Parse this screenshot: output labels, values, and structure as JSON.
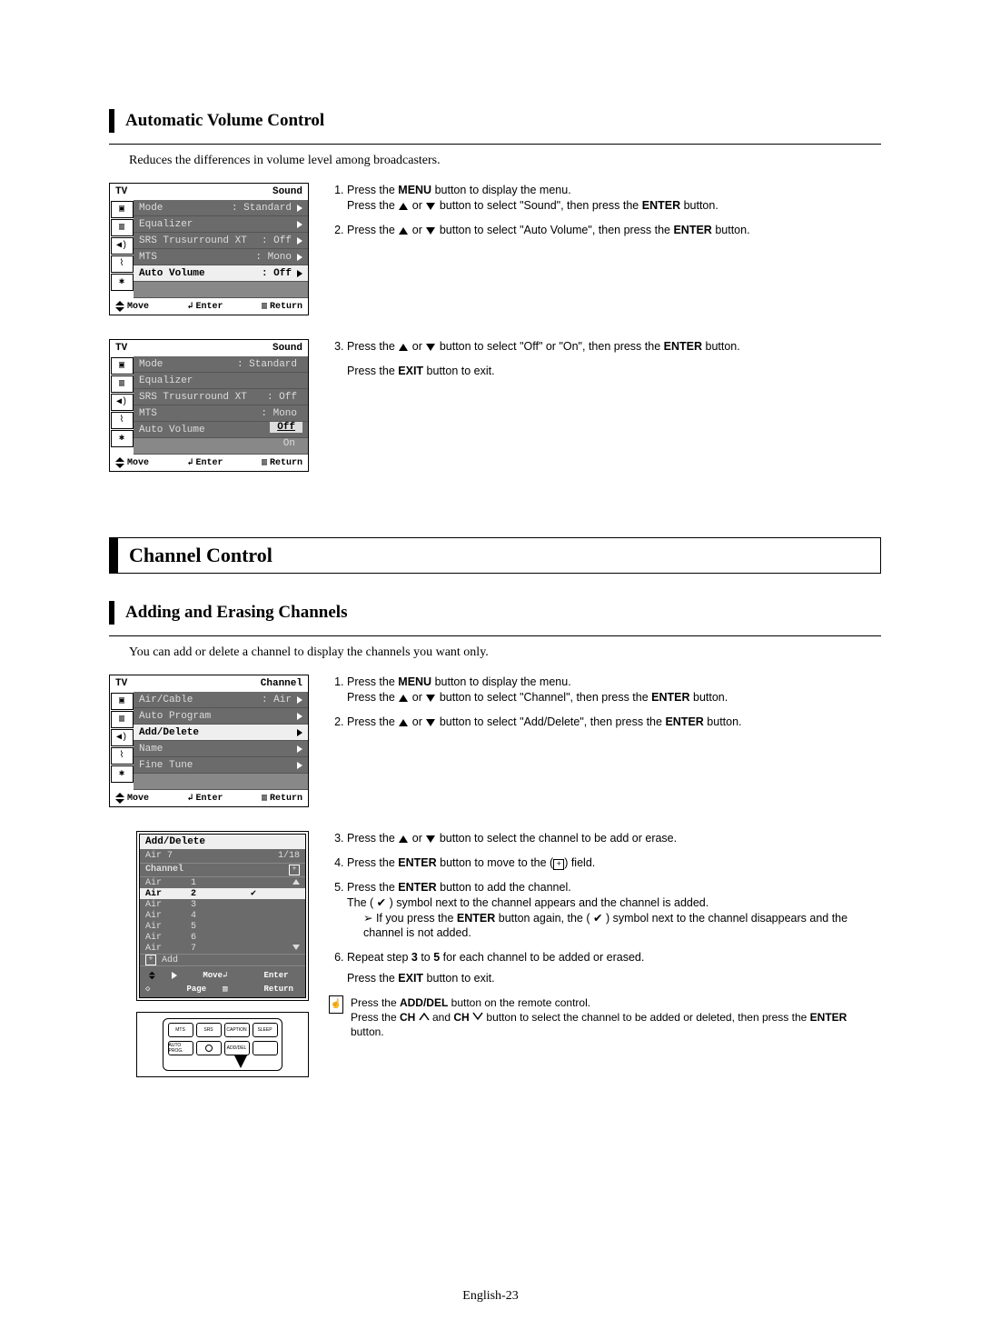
{
  "section1": {
    "heading": "Automatic Volume Control",
    "description": "Reduces the differences in volume level among broadcasters."
  },
  "osd1": {
    "tv": "TV",
    "title": "Sound",
    "rows": [
      {
        "label": "Mode",
        "val": ": Standard"
      },
      {
        "label": "Equalizer",
        "val": ""
      },
      {
        "label": "SRS Trusurround XT",
        "val": ": Off"
      },
      {
        "label": "MTS",
        "val": ": Mono"
      },
      {
        "label": "Auto Volume",
        "val": ": Off"
      }
    ],
    "foot": {
      "move": "Move",
      "enter": "Enter",
      "return": "Return"
    }
  },
  "osd2": {
    "tv": "TV",
    "title": "Sound",
    "rows": [
      {
        "label": "Mode",
        "val": ": Standard"
      },
      {
        "label": "Equalizer",
        "val": ""
      },
      {
        "label": "SRS Trusurround XT",
        "val": ": Off"
      },
      {
        "label": "MTS",
        "val": ": Mono"
      },
      {
        "label": "Auto Volume",
        "val": ":"
      }
    ],
    "options": {
      "off": "Off",
      "on": "On"
    },
    "foot": {
      "move": "Move",
      "enter": "Enter",
      "return": "Return"
    }
  },
  "steps1": {
    "s1a": "Press the ",
    "s1b": "MENU",
    "s1c": " button to display the menu.",
    "s1d": "Press the ",
    "s1e": " or ",
    "s1f": " button to select \"Sound\", then press the ",
    "s1g": "ENTER",
    "s1h": " button.",
    "s2a": "Press the ",
    "s2b": " or ",
    "s2c": " button to select \"Auto Volume\", then press the ",
    "s2d": "ENTER",
    "s2e": " button.",
    "s3a": "Press the ",
    "s3b": " or ",
    "s3c": " button to select \"Off\" or \"On\", then press the ",
    "s3d": "ENTER",
    "s3e": " button.",
    "s3f": "Press the ",
    "s3g": "EXIT",
    "s3h": " button to exit."
  },
  "sectionMain": {
    "heading": "Channel Control"
  },
  "section2": {
    "heading": "Adding and Erasing Channels",
    "description": "You can add or delete a channel to display the channels you want only."
  },
  "osd3": {
    "tv": "TV",
    "title": "Channel",
    "rows": [
      {
        "label": "Air/Cable",
        "val": ": Air"
      },
      {
        "label": "Auto Program",
        "val": ""
      },
      {
        "label": "Add/Delete",
        "val": ""
      },
      {
        "label": "Name",
        "val": ""
      },
      {
        "label": "Fine Tune",
        "val": ""
      }
    ],
    "foot": {
      "move": "Move",
      "enter": "Enter",
      "return": "Return"
    }
  },
  "addbox": {
    "title": "Add/Delete",
    "head_l": "Air    7",
    "head_r": "1/18",
    "col": "Channel",
    "rows": [
      {
        "src": "Air",
        "num": "1",
        "mark": ""
      },
      {
        "src": "Air",
        "num": "2",
        "mark": "check",
        "sel": true
      },
      {
        "src": "Air",
        "num": "3",
        "mark": ""
      },
      {
        "src": "Air",
        "num": "4",
        "mark": ""
      },
      {
        "src": "Air",
        "num": "5",
        "mark": ""
      },
      {
        "src": "Air",
        "num": "6",
        "mark": ""
      },
      {
        "src": "Air",
        "num": "7",
        "mark": ""
      }
    ],
    "add": "Add",
    "foot": {
      "move": "Move",
      "enter": "Enter",
      "page": "Page",
      "return": "Return"
    }
  },
  "remote": {
    "b1": "MTS",
    "b2": "SRS",
    "b3": "CAPTION",
    "b4": "SLEEP",
    "b5": "AUTO PROG.",
    "b6": "ADD/DEL"
  },
  "steps2": {
    "s1a": "Press the ",
    "s1b": "MENU",
    "s1c": " button to display the menu.",
    "s1d": "Press the ",
    "s1e": " or ",
    "s1f": " button to select \"Channel\", then press the ",
    "s1g": "ENTER",
    "s1h": " button.",
    "s2a": "Press the ",
    "s2b": " or ",
    "s2c": " button to select \"Add/Delete\", then press the ",
    "s2d": "ENTER",
    "s2e": " button.",
    "s3a": "Press the ",
    "s3b": " or ",
    "s3c": " button to select the channel to be add or erase.",
    "s4a": "Press the ",
    "s4b": "ENTER",
    "s4c": " button to move to the (",
    "s4d": ") field.",
    "s5a": "Press the ",
    "s5b": "ENTER",
    "s5c": " button to add the channel.",
    "s5d": "The ( ",
    "s5e": " ) symbol next to the channel appears and the channel is added.",
    "s5f": "If you press the ",
    "s5g": "ENTER",
    "s5h": " button again, the ( ",
    "s5i": " ) symbol next to the channel disappears and the channel is not added.",
    "s6a": "Repeat step ",
    "s6b": "3",
    "s6c": " to ",
    "s6d": "5",
    "s6e": " for each channel to be added or erased.",
    "s6f": "Press the ",
    "s6g": "EXIT",
    "s6h": " button to exit."
  },
  "note": {
    "a": "Press the ",
    "b": "ADD/DEL",
    "c": " button on the remote control.",
    "d": "Press the ",
    "e": "CH",
    "f": " and ",
    "g": "CH",
    "h": " button to select the channel to be added or deleted, then press the ",
    "i": "ENTER",
    "j": " button."
  },
  "footer": "English-23"
}
